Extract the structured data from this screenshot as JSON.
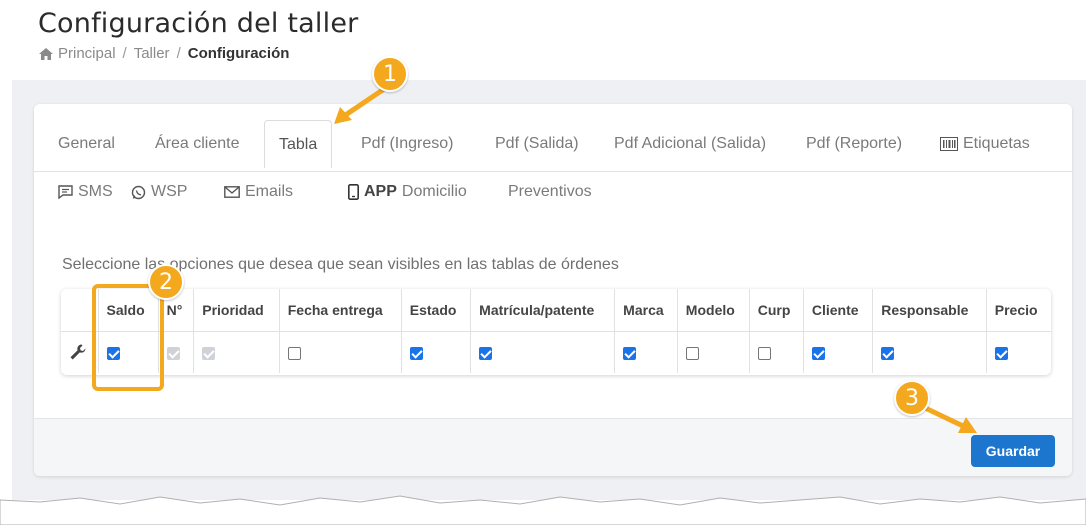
{
  "page": {
    "title": "Configuración del taller",
    "breadcrumb": [
      "Principal",
      "Taller",
      "Configuración"
    ],
    "breadcrumb_sep": "/"
  },
  "tabs": {
    "row1": [
      "General",
      "Área cliente",
      "Tabla",
      "Pdf (Ingreso)",
      "Pdf (Salida)",
      "Pdf Adicional (Salida)",
      "Pdf (Reporte)",
      "Etiquetas"
    ],
    "row2": [
      "SMS",
      "WSP",
      "Emails",
      "APP",
      "Domicilio",
      "Preventivos"
    ],
    "active": "Tabla"
  },
  "instructions": "Seleccione las opciones que desea que sean visibles en las tablas de órdenes",
  "table": {
    "columns": [
      "Saldo",
      "N°",
      "Prioridad",
      "Fecha entrega",
      "Estado",
      "Matrícula/patente",
      "Marca",
      "Modelo",
      "Curp",
      "Cliente",
      "Responsable",
      "Precio"
    ],
    "states": [
      "checked",
      "disabled",
      "disabled",
      "unchecked",
      "checked",
      "checked",
      "checked",
      "unchecked",
      "unchecked",
      "checked",
      "checked",
      "checked"
    ]
  },
  "footer": {
    "save_label": "Guardar"
  },
  "annotations": [
    "1",
    "2",
    "3"
  ],
  "colors": {
    "accent": "#f4a81d",
    "primary": "#1d76ce",
    "checkbox": "#1a73e8"
  }
}
